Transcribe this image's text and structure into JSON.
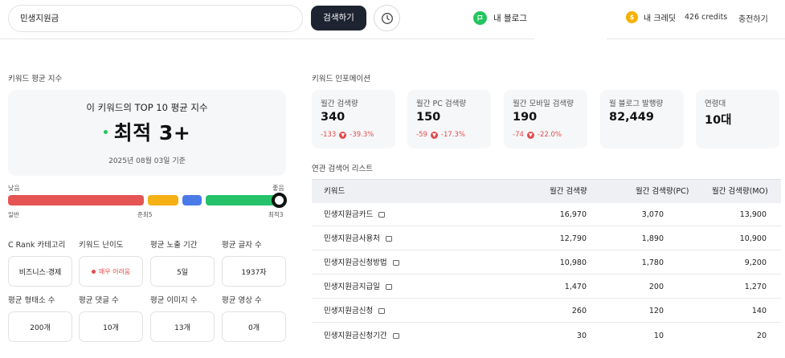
{
  "search": {
    "value": "민생지원금",
    "button_label": "검색하기"
  },
  "header": {
    "blog_label": "내 블로그",
    "credit_label": "내 크레딧",
    "credit_value": "426 credits",
    "charge_label": "충전하기"
  },
  "left": {
    "section_title": "키워드 평균 지수",
    "card_heading": "이 키워드의 TOP 10 평균 지수",
    "card_value": "최적 3+",
    "card_date": "2025년 08월 03일 기준",
    "scale_low": "낮음",
    "scale_high": "좋음",
    "scale_labels": [
      "일반",
      "준최5",
      "최적3"
    ],
    "scale_level_fraction": 1.0,
    "scale_colors": [
      "#e55353",
      "#f5b014",
      "#4a7be8",
      "#25c26a"
    ],
    "stats_row1": [
      {
        "label": "C Rank 카테고리",
        "value": "비즈니스·경제"
      },
      {
        "label": "키워드 난이도",
        "value": "매우 어려움"
      },
      {
        "label": "평균 노출 기간",
        "value": "5일"
      },
      {
        "label": "평균 글자 수",
        "value": "1937자"
      }
    ],
    "stats_row2": [
      {
        "label": "평균 형태소 수",
        "value": "200개"
      },
      {
        "label": "평균 댓글 수",
        "value": "10개"
      },
      {
        "label": "평균 이미지 수",
        "value": "13개"
      },
      {
        "label": "평균 영상 수",
        "value": "0개"
      }
    ]
  },
  "right": {
    "section_title": "키워드 인포메이션",
    "info_cards": [
      {
        "label": "월간 검색량",
        "value": "340",
        "change_abs": "-133",
        "change_pct": "-39.3%"
      },
      {
        "label": "월간 PC 검색량",
        "value": "150",
        "change_abs": "-59",
        "change_pct": "-17.3%"
      },
      {
        "label": "월간 모바일 검색량",
        "value": "190",
        "change_abs": "-74",
        "change_pct": "-22.0%"
      },
      {
        "label": "월 블로그 발행량",
        "value": "82,449"
      },
      {
        "label": "연령대",
        "value": "10대"
      }
    ],
    "related_title": "연관 검색어 리스트",
    "table_headers": [
      "키워드",
      "월간 검색량",
      "월간 검색량(PC)",
      "월간 검색량(MO)"
    ],
    "table_rows": [
      {
        "keyword": "민생지원금카드",
        "total": "16,970",
        "pc": "3,070",
        "mo": "13,900"
      },
      {
        "keyword": "민생지원금사용처",
        "total": "12,790",
        "pc": "1,890",
        "mo": "10,900"
      },
      {
        "keyword": "민생지원금신청방법",
        "total": "10,980",
        "pc": "1,780",
        "mo": "9,200"
      },
      {
        "keyword": "민생지원금지급일",
        "total": "1,470",
        "pc": "200",
        "mo": "1,270"
      },
      {
        "keyword": "민생지원금신청",
        "total": "260",
        "pc": "120",
        "mo": "140"
      },
      {
        "keyword": "민생지원금신청기간",
        "total": "30",
        "pc": "10",
        "mo": "20"
      }
    ]
  }
}
